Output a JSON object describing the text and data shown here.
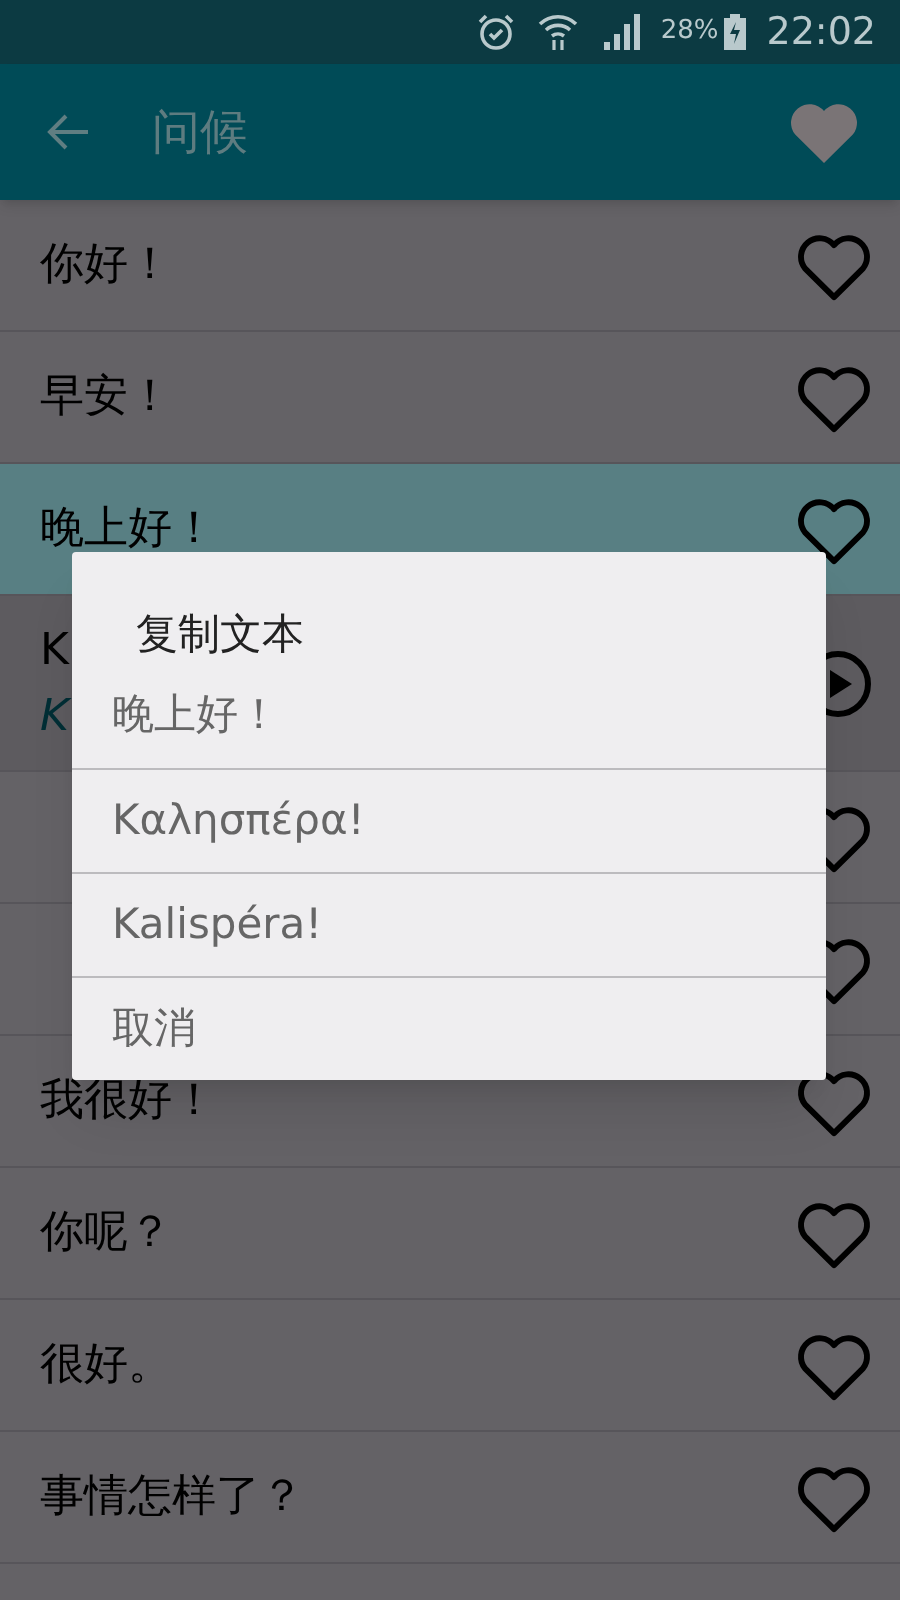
{
  "status_bar": {
    "battery": "28%",
    "time": "22:02"
  },
  "app_bar": {
    "title": "问候"
  },
  "phrases": [
    {
      "kind": "phrase",
      "text": "你好！",
      "selected": false
    },
    {
      "kind": "phrase",
      "text": "早安！",
      "selected": false
    },
    {
      "kind": "phrase",
      "text": "晚上好！",
      "selected": true
    },
    {
      "kind": "expanded",
      "text": "K",
      "translit": "K",
      "selected": false
    },
    {
      "kind": "phrase",
      "selected": false
    },
    {
      "kind": "phrase",
      "selected": false
    },
    {
      "kind": "phrase",
      "text": "我很好！",
      "selected": false
    },
    {
      "kind": "phrase",
      "text": "你呢？",
      "selected": false
    },
    {
      "kind": "phrase",
      "text": "很好。",
      "selected": false
    },
    {
      "kind": "phrase",
      "text": "事情怎样了？",
      "selected": false
    }
  ],
  "dialog": {
    "title": "复制文本",
    "options": [
      "晚上好！",
      "Καλησπέρα!",
      "Kalispéra!",
      "取消"
    ]
  }
}
